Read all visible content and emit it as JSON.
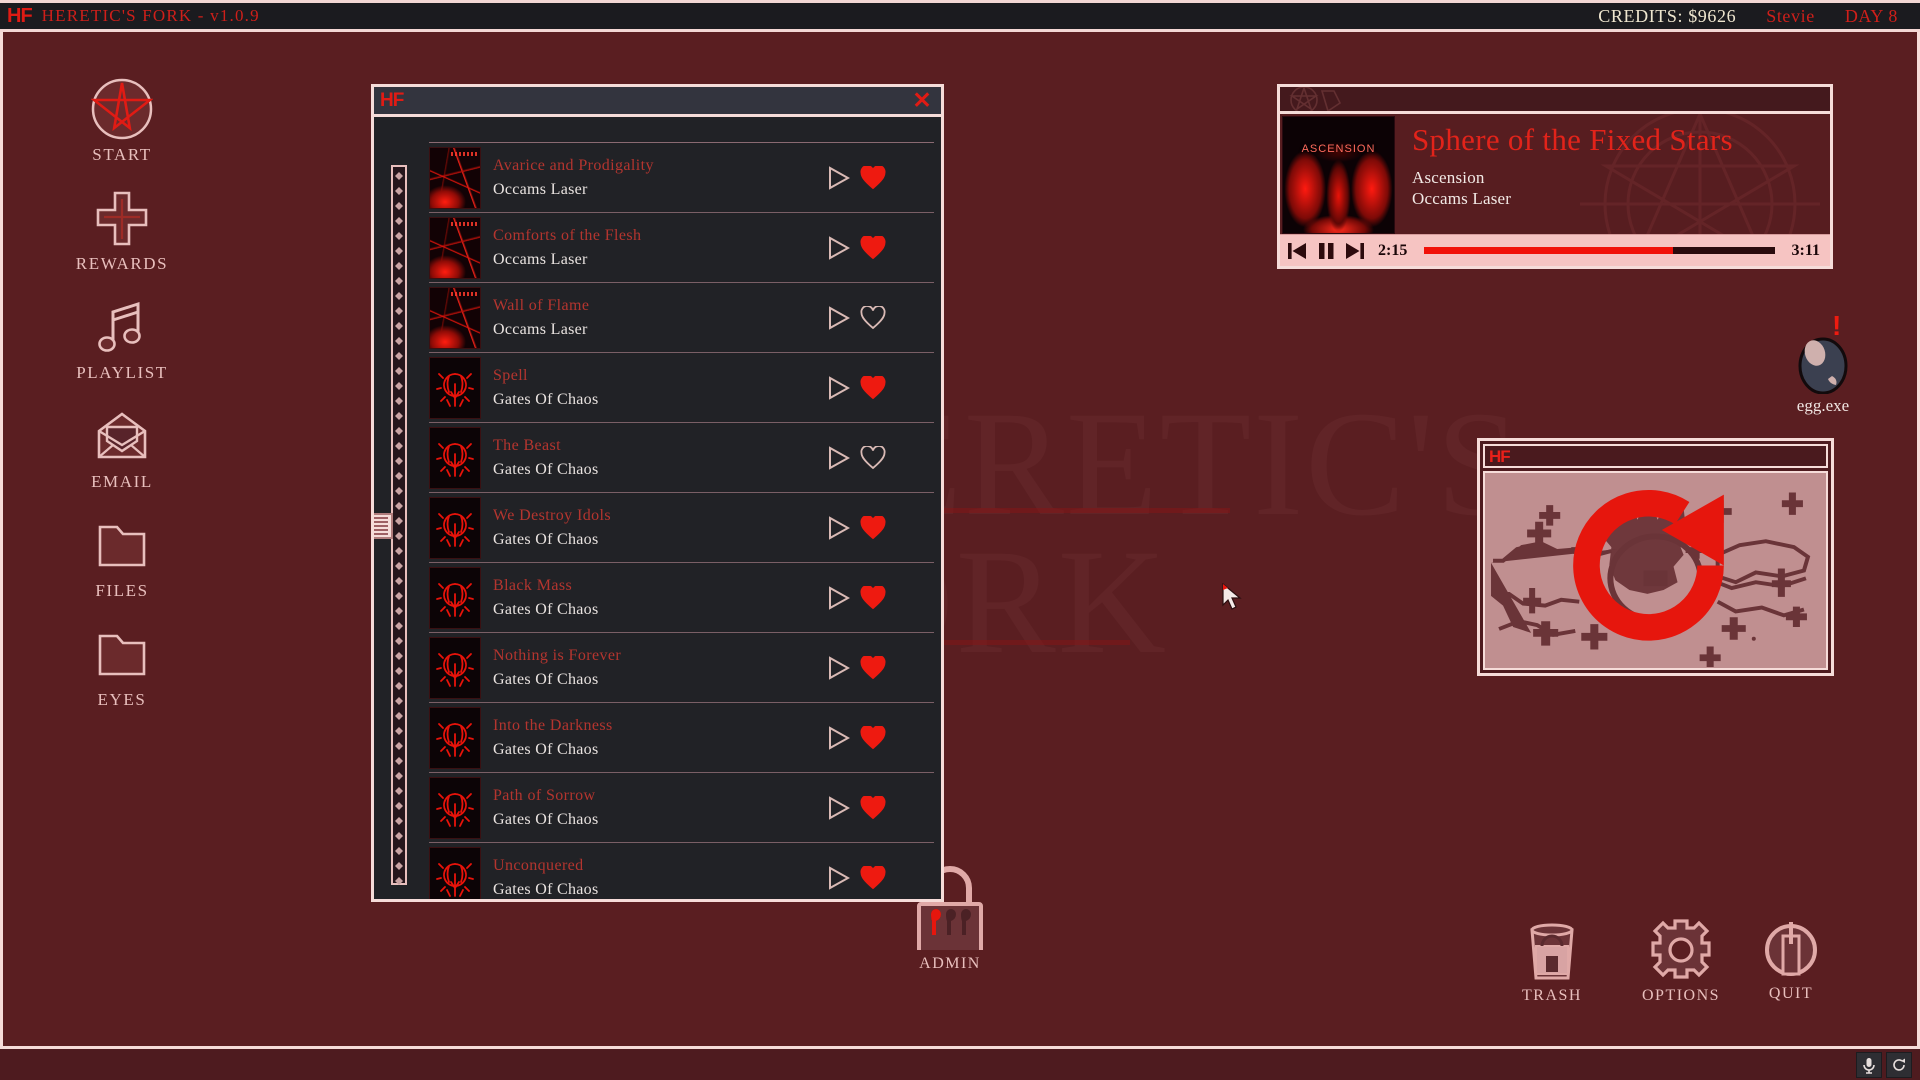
{
  "topbar": {
    "logo": "HF",
    "title": "HERETIC'S FORK - v1.0.9",
    "credits": "CREDITS: $9626",
    "player_name": "Stevie",
    "day": "DAY 8"
  },
  "desktop": {
    "watermark": "HERETIC'S\nFORK",
    "background_color": "#5a1e21",
    "accent_color": "#e01b14",
    "frame_color": "#f6dcd9"
  },
  "dock": {
    "items": [
      {
        "label": "START",
        "icon": "pentagram-icon"
      },
      {
        "label": "REWARDS",
        "icon": "inverted-cross-icon"
      },
      {
        "label": "PLAYLIST",
        "icon": "music-note-icon"
      },
      {
        "label": "EMAIL",
        "icon": "envelope-icon"
      },
      {
        "label": "FILES",
        "icon": "folder-icon"
      },
      {
        "label": "EYES",
        "icon": "folder-icon"
      }
    ]
  },
  "floor_items": [
    {
      "label": "ADMIN",
      "icon": "padlock-icon"
    },
    {
      "label": "TRASH",
      "icon": "trash-can-icon"
    },
    {
      "label": "OPTIONS",
      "icon": "gear-icon"
    },
    {
      "label": "QUIT",
      "icon": "power-icon"
    }
  ],
  "playlist_window": {
    "logo": "HF",
    "close_label": "✕",
    "tracks": [
      {
        "title": "Avarice and Prodigality",
        "artist": "Occams Laser",
        "art": "occams",
        "liked": true,
        "play_label": "play"
      },
      {
        "title": "Comforts of the Flesh",
        "artist": "Occams Laser",
        "art": "occams",
        "liked": true,
        "play_label": "play"
      },
      {
        "title": "Wall of Flame",
        "artist": "Occams Laser",
        "art": "occams",
        "liked": false,
        "play_label": "play"
      },
      {
        "title": "Spell",
        "artist": "Gates Of Chaos",
        "art": "gates",
        "liked": true,
        "play_label": "play"
      },
      {
        "title": "The Beast",
        "artist": "Gates Of Chaos",
        "art": "gates",
        "liked": false,
        "play_label": "play"
      },
      {
        "title": "We Destroy Idols",
        "artist": "Gates Of Chaos",
        "art": "gates",
        "liked": true,
        "play_label": "play"
      },
      {
        "title": "Black Mass",
        "artist": "Gates Of Chaos",
        "art": "gates",
        "liked": true,
        "play_label": "play"
      },
      {
        "title": "Nothing is Forever",
        "artist": "Gates Of Chaos",
        "art": "gates",
        "liked": true,
        "play_label": "play"
      },
      {
        "title": "Into the Darkness",
        "artist": "Gates Of Chaos",
        "art": "gates",
        "liked": true,
        "play_label": "play"
      },
      {
        "title": "Path of Sorrow",
        "artist": "Gates Of Chaos",
        "art": "gates",
        "liked": true,
        "play_label": "play"
      },
      {
        "title": "Unconquered",
        "artist": "Gates Of Chaos",
        "art": "gates",
        "liked": true,
        "play_label": "play"
      }
    ]
  },
  "now_playing": {
    "album_art_label": "ASCENSION",
    "track_title": "Sphere of the Fixed Stars",
    "album": "Ascension",
    "artist": "Occams Laser",
    "time_current": "2:15",
    "time_total": "3:11",
    "progress_percent": 71,
    "controls": {
      "previous": "prev-track",
      "pause": "pause",
      "next": "next-track"
    }
  },
  "egg_icon": {
    "label": "egg.exe",
    "alert": "!"
  },
  "map_window": {
    "logo": "HF",
    "refresh_label": "refresh"
  },
  "taskbar": {
    "tray": [
      {
        "icon": "microphone-icon"
      },
      {
        "icon": "refresh-icon"
      }
    ]
  }
}
